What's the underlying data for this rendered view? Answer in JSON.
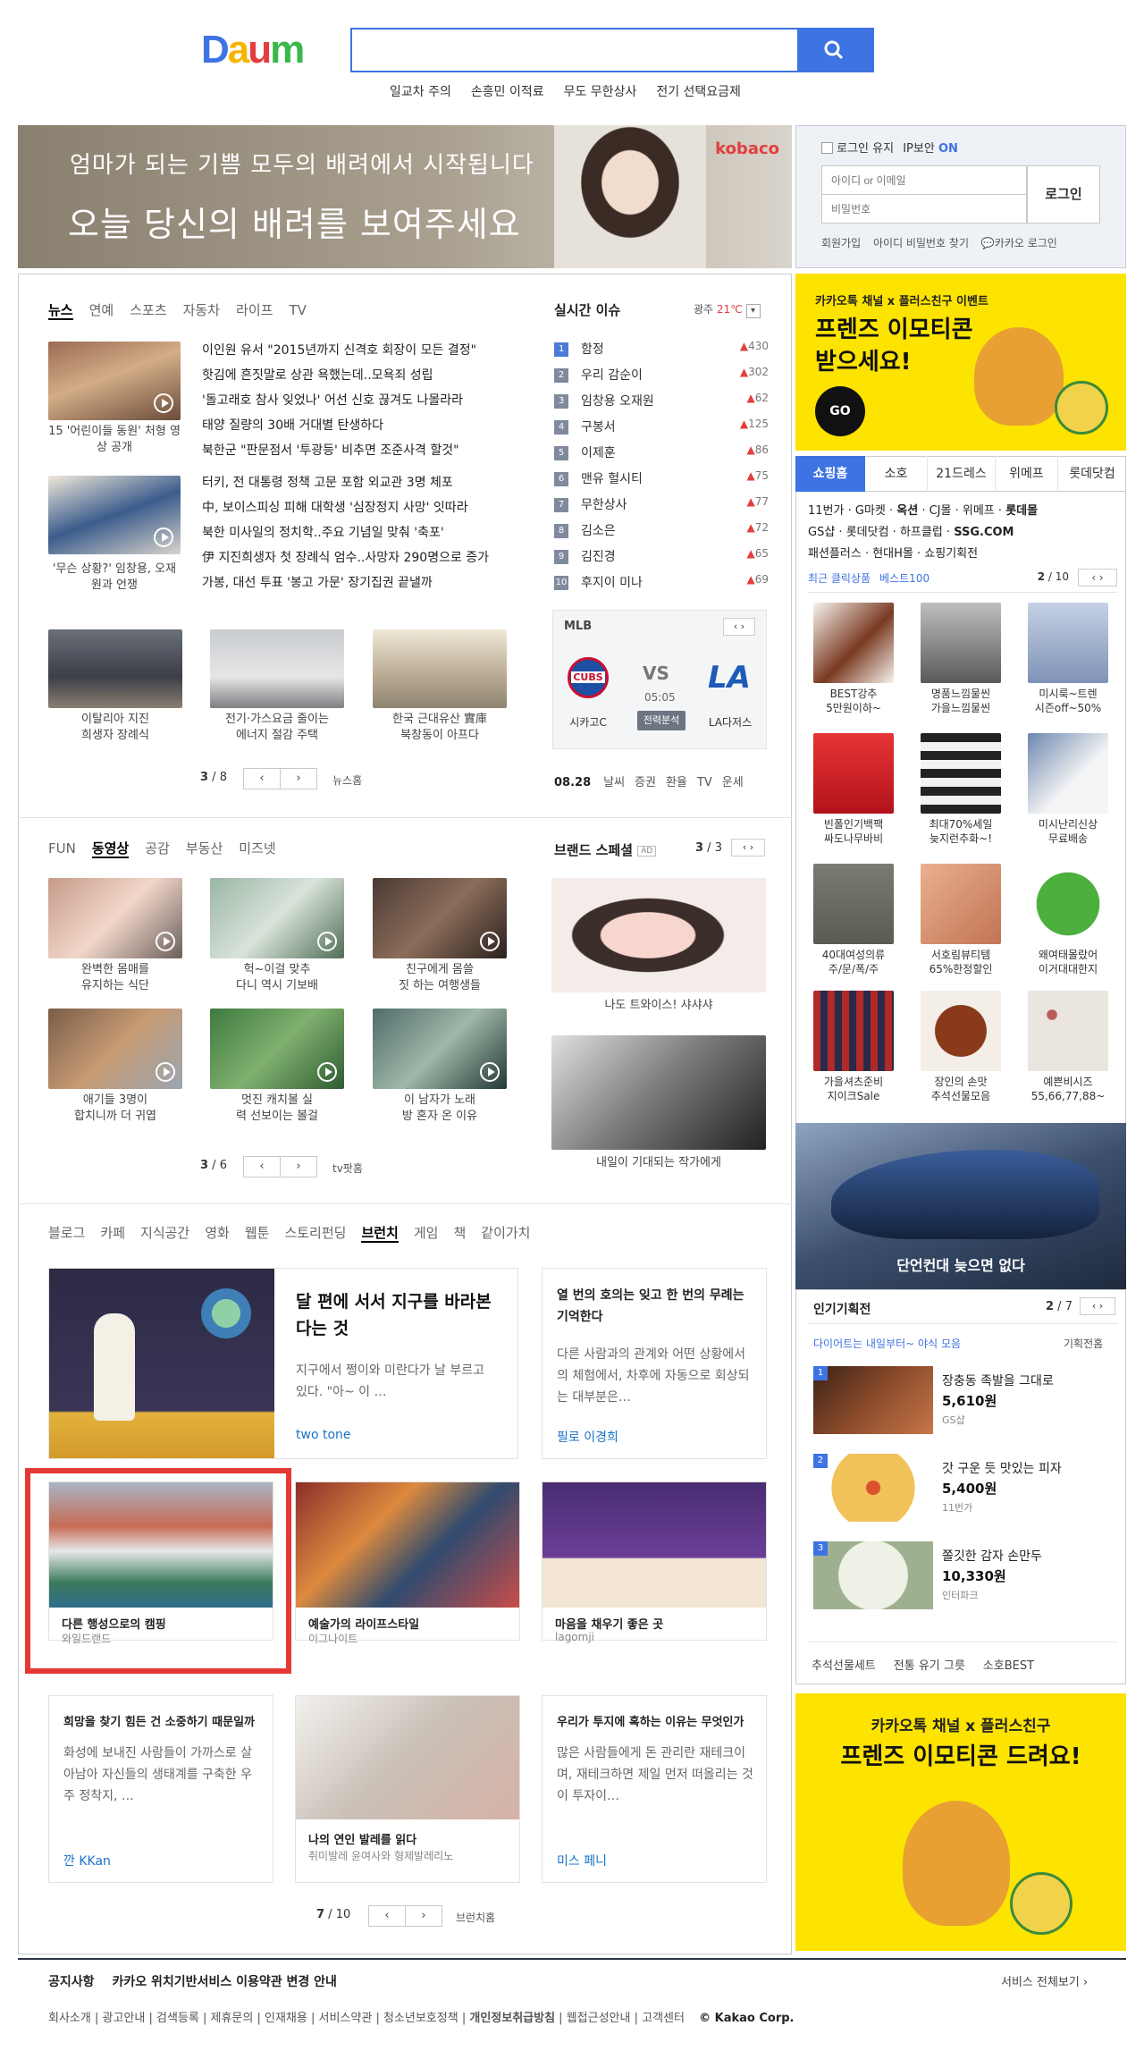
{
  "logo": "Daum",
  "search": {
    "placeholder": ""
  },
  "trending_links": [
    "일교차 주의",
    "손흥민 이적료",
    "무도 무한상사",
    "전기 선택요금제"
  ],
  "banner": {
    "line1": "엄마가 되는 기쁨 모두의 배려에서 시작됩니다",
    "line2": "오늘 당신의 배려를 보여주세요",
    "brand": "kobaco"
  },
  "login": {
    "keep": "로그인 유지",
    "ip_security": "IP보안",
    "ip_state": "ON",
    "id_placeholder": "아이디 or 이메일",
    "pw_placeholder": "비밀번호",
    "button": "로그인",
    "links": [
      "회원가입",
      "아이디 비밀번호 찾기",
      "카카오 로그인"
    ]
  },
  "news": {
    "tabs": [
      "뉴스",
      "연예",
      "스포츠",
      "자동차",
      "라이프",
      "TV"
    ],
    "thumbs": [
      {
        "caption": "15 '어린이들 동원' 처형 영상 공개"
      },
      {
        "caption": "'무슨 상황?' 임창용, 오재원과 언쟁"
      }
    ],
    "headlines_a": [
      "이인원 유서 \"2015년까지 신격호 회장이 모든 결정\"",
      "핫김에 흔짓말로 상관 욕했는데..모욕죄 성립",
      "'돌고래호 참사 잊었나' 어선 신호 끊겨도 나몰라라",
      "태양 질량의 30배 거대별 탄생하다",
      "북한군 \"판문점서 '투광등' 비추면 조준사격 할것\""
    ],
    "headlines_b": [
      "터키, 전 대통령 정책 고문 포함 외교관 3명 체포",
      "中, 보이스피싱 피해 대학생 '심장정지 사망' 잇따라",
      "북한 미사일의 정치학..주요 기념일 맞춰 '축포'",
      "伊 지진희생자 첫 장례식 엄수..사망자 290명으로 증가",
      "가봉, 대선 투표 '봉고 가문' 장기집권 끝낼까"
    ],
    "bottom": [
      {
        "caption": "이탈리아 지진\n희생자 장례식"
      },
      {
        "caption": "전기·가스요금 줄이는\n에너지 절감 주택"
      },
      {
        "caption": "한국 근대유산 實庫\n북창동이 아프다"
      }
    ],
    "page": "3",
    "total": "8",
    "home": "뉴스홈"
  },
  "realtime": {
    "title": "실시간 이슈",
    "region": "광주",
    "temp": "21℃",
    "items": [
      {
        "rank": "1",
        "kw": "함정",
        "delta": "430"
      },
      {
        "rank": "2",
        "kw": "우리 감순이",
        "delta": "302"
      },
      {
        "rank": "3",
        "kw": "임창용 오재원",
        "delta": "62"
      },
      {
        "rank": "4",
        "kw": "구봉서",
        "delta": "125"
      },
      {
        "rank": "5",
        "kw": "이제훈",
        "delta": "86"
      },
      {
        "rank": "6",
        "kw": "맨유 헐시티",
        "delta": "75"
      },
      {
        "rank": "7",
        "kw": "무한상사",
        "delta": "77"
      },
      {
        "rank": "8",
        "kw": "김소은",
        "delta": "72"
      },
      {
        "rank": "9",
        "kw": "김진경",
        "delta": "65"
      },
      {
        "rank": "10",
        "kw": "후지이 미나",
        "delta": "69"
      }
    ]
  },
  "mlb": {
    "label": "MLB",
    "home": "시카고C",
    "away": "LA다저스",
    "vs": "VS",
    "time": "05:05",
    "state": "전력분석"
  },
  "date_bar": {
    "date": "08.28",
    "links": [
      "날씨",
      "증권",
      "환율",
      "TV",
      "운세"
    ]
  },
  "fun": {
    "tabs": [
      "FUN",
      "동영상",
      "공감",
      "부동산",
      "미즈넷"
    ],
    "items": [
      {
        "caption": "완벽한 몸매를\n유지하는 식단"
      },
      {
        "caption": "헉~이걸 맞추\n다니 역시 기보배"
      },
      {
        "caption": "친구에게 몸쓸\n짓 하는 여행생들"
      },
      {
        "caption": "애기들 3명이\n합치니까 더 귀엽"
      },
      {
        "caption": "멋진 캐치볼 실\n력 선보이는 볼걸"
      },
      {
        "caption": "이 남자가 노래\n방 혼자 온 이유"
      }
    ],
    "page": "3",
    "total": "6",
    "home": "tv팟홈"
  },
  "brand": {
    "title": "브랜드 스페셜",
    "ad": "AD",
    "page": "3",
    "total": "3",
    "items": [
      {
        "caption": "나도 트와이스! 샤샤샤"
      },
      {
        "caption": "내일이 기대되는 작가에게"
      }
    ]
  },
  "branch": {
    "tabs": [
      "블로그",
      "카페",
      "지식공간",
      "영화",
      "웹툰",
      "스토리펀딩",
      "브런치",
      "게임",
      "책",
      "같이가치"
    ],
    "feature": {
      "title": "달 편에 서서 지구를 바라본다는 것",
      "desc": "지구에서 쩡이와 미란다가 날 부르고 있다. \"아~ 이 …",
      "author": "two tone"
    },
    "text1": {
      "title": "열 번의 호의는 잊고 한 번의 무례는 기억한다",
      "desc": "다른 사람과의 관계와 어떤 상황에서의 체험에서, 차후에 자동으로 회상되는 대부분은…",
      "author": "필로 이경희"
    },
    "cards": [
      {
        "title": "다른 행성으로의 캠핑",
        "author": "와일드랜드"
      },
      {
        "title": "예술가의 라이프스타일",
        "author": "이그나이트"
      },
      {
        "title": "마음을 채우기 좋은 곳",
        "author": "lagomji"
      }
    ],
    "text2": {
      "title": "희망을 찾기 힘든 건 소중하기 때문일까",
      "desc": "화성에 보내진 사람들이 가까스로 살아남아 자신들의 생태계를 구축한 우주 정착지, …",
      "author": "깐 KKan"
    },
    "card4": {
      "title": "나의 연인 발레를 읽다",
      "author": "취미발레 윤여사와 형제발레리노"
    },
    "text3": {
      "title": "우리가 투지에 혹하는 이유는 무엇인가",
      "desc": "많은 사람들에게 돈 관리란 재테크이며, 재테크하면 제일 먼저 떠올리는 것이 투자이…",
      "author": "미스 페니"
    },
    "page": "7",
    "total": "10",
    "home": "브런치홈"
  },
  "kakao_ad1": {
    "top": "카카오톡 채널 x 플러스친구 이벤트",
    "line1": "프렌즈 이모티콘",
    "line2": "받으세요!",
    "go": "GO"
  },
  "shopping": {
    "tabs": [
      "쇼핑홈",
      "소호",
      "21드레스",
      "위메프",
      "롯데닷컴"
    ],
    "malls": [
      "11번가",
      "G마켓",
      "옥션",
      "CJ몰",
      "위메프",
      "롯데몰",
      "GS샵",
      "롯데닷컴",
      "하프클럽",
      "SSG.COM",
      "패션플러스",
      "현대H몰",
      "쇼핑기획전"
    ],
    "sub_tabs": [
      "최근 클릭상품",
      "베스트100"
    ],
    "page": "2",
    "total": "10",
    "items": [
      {
        "label": "BEST강추\n5만원이하~"
      },
      {
        "label": "명품느낌물씬\n가을느낌물씬"
      },
      {
        "label": "미시룩~트렌\n시즌off~50%"
      },
      {
        "label": "빈폴인기백팩\n싸도나무바비"
      },
      {
        "label": "최대70%세일\n늦지런추화~!"
      },
      {
        "label": "미시난리신상\n무료배송"
      },
      {
        "label": "40대여성의류\n주/문/폭/주"
      },
      {
        "label": "서호림뷰티템\n65%한정할인"
      },
      {
        "label": "왜여태몰랐어\n이거대대한지"
      },
      {
        "label": "가을셔츠준비\n지이크Sale"
      },
      {
        "label": "장인의 손맛\n추석선물모음"
      },
      {
        "label": "예쁜비시즈\n55,66,77,88~"
      }
    ],
    "banner": "단언컨대 늦으면 없다"
  },
  "plans": {
    "title": "인기기획전",
    "page": "2",
    "total": "7",
    "sub": "다이어트는 내일부터~ 야식 모음",
    "more": "기획전홈",
    "items": [
      {
        "rank": "1",
        "name": "장충동 족발을 그대로",
        "price": "5,610원",
        "shop": "GS샵"
      },
      {
        "rank": "2",
        "name": "갓 구운 듯 맛있는 피자",
        "price": "5,400원",
        "shop": "11번가"
      },
      {
        "rank": "3",
        "name": "쫄깃한 감자 손만두",
        "price": "10,330원",
        "shop": "인터파크"
      }
    ],
    "links": [
      "추석선물세트",
      "전통 유기 그릇",
      "소호BEST"
    ]
  },
  "kakao_ad2": {
    "top": "카카오톡 채널 x 플러스친구",
    "line1": "프렌즈 이모티콘 드려요!"
  },
  "footer": {
    "notice_label": "공지사항",
    "notice": "카카오 위치기반서비스 이용약관 변경 안내",
    "all_services": "서비스 전체보기",
    "links": [
      "회사소개",
      "광고안내",
      "검색등록",
      "제휴문의",
      "인재채용",
      "서비스약관",
      "청소년보호정책",
      "개인정보취급방침",
      "웹접근성안내",
      "고객센터"
    ],
    "copyright": "© Kakao Corp."
  },
  "colors": {
    "accent": "#3d73e3",
    "red": "#e33e3e",
    "yellow": "#fde300",
    "link_blue": "#1a73c7"
  }
}
